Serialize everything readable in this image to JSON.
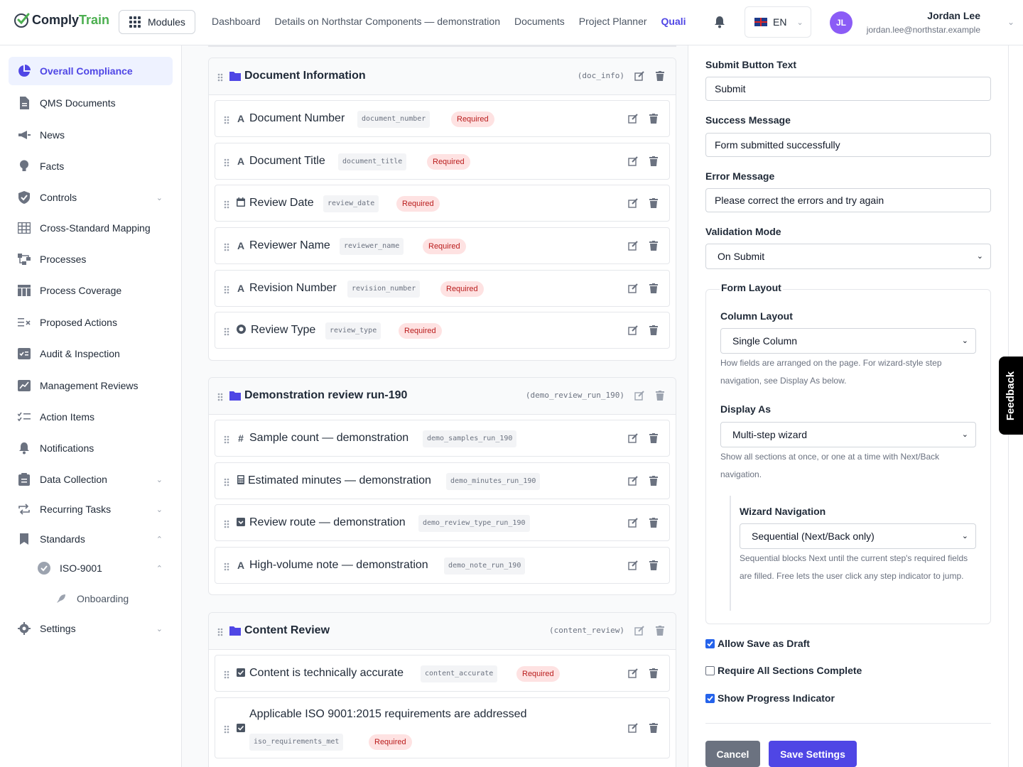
{
  "header": {
    "logo_part1": "Comply",
    "logo_part2": "Train",
    "modules_label": "Modules",
    "nav": [
      "Dashboard",
      "Details on Northstar Components — demonstration",
      "Documents",
      "Project Planner",
      "Quali"
    ],
    "language": "EN",
    "user": {
      "initials": "JL",
      "name": "Jordan Lee",
      "email": "jordan.lee@northstar.example"
    }
  },
  "sidebar": {
    "items": [
      {
        "label": "Overall Compliance",
        "icon": "pie-chart-icon",
        "active": true
      },
      {
        "label": "QMS Documents",
        "icon": "document-icon"
      },
      {
        "label": "News",
        "icon": "megaphone-icon"
      },
      {
        "label": "Facts",
        "icon": "lightbulb-icon"
      },
      {
        "label": "Controls",
        "icon": "shield-icon",
        "expandable": true
      },
      {
        "label": "Cross-Standard Mapping",
        "icon": "table-icon"
      },
      {
        "label": "Processes",
        "icon": "flow-icon"
      },
      {
        "label": "Process Coverage",
        "icon": "columns-icon"
      },
      {
        "label": "Proposed Actions",
        "icon": "list-x-icon"
      },
      {
        "label": "Audit & Inspection",
        "icon": "clipboard-check-icon"
      },
      {
        "label": "Management Reviews",
        "icon": "chart-review-icon"
      },
      {
        "label": "Action Items",
        "icon": "checklist-icon"
      },
      {
        "label": "Notifications",
        "icon": "bell-icon"
      },
      {
        "label": "Data Collection",
        "icon": "clipboard-icon",
        "expandable": true
      },
      {
        "label": "Recurring Tasks",
        "icon": "repeat-icon",
        "expandable": true
      },
      {
        "label": "Standards",
        "icon": "bookmark-icon",
        "expanded": true
      },
      {
        "label": "ISO-9001",
        "icon": "badge-check-icon",
        "expanded": true
      },
      {
        "label": "Onboarding",
        "icon": "rocket-icon"
      },
      {
        "label": "Settings",
        "icon": "gear-icon",
        "expandable": true
      }
    ]
  },
  "sections": [
    {
      "title": "Document Information",
      "key": "(doc_info)",
      "fields": [
        {
          "icon": "A",
          "label": "Document Number",
          "key": "document_number",
          "required": "Required"
        },
        {
          "icon": "A",
          "label": "Document Title",
          "key": "document_title",
          "required": "Required"
        },
        {
          "icon": "cal",
          "label": "Review Date",
          "key": "review_date",
          "required": "Required"
        },
        {
          "icon": "A",
          "label": "Reviewer Name",
          "key": "reviewer_name",
          "required": "Required"
        },
        {
          "icon": "A",
          "label": "Revision Number",
          "key": "revision_number",
          "required": "Required"
        },
        {
          "icon": "radio",
          "label": "Review Type",
          "key": "review_type",
          "required": "Required"
        }
      ]
    },
    {
      "title": "Demonstration review run-190",
      "key": "(demo_review_run_190)",
      "fields": [
        {
          "icon": "#",
          "label": "Sample count — demonstration",
          "key": "demo_samples_run_190"
        },
        {
          "icon": "calc",
          "label": "Estimated minutes — demonstration",
          "key": "demo_minutes_run_190"
        },
        {
          "icon": "select",
          "label": "Review route — demonstration",
          "key": "demo_review_type_run_190"
        },
        {
          "icon": "A",
          "label": "High-volume note — demonstration",
          "key": "demo_note_run_190"
        }
      ]
    },
    {
      "title": "Content Review",
      "key": "(content_review)",
      "fields": [
        {
          "icon": "check",
          "label": "Content is technically accurate",
          "key": "content_accurate",
          "required": "Required"
        },
        {
          "icon": "check",
          "label": "Applicable ISO 9001:2015 requirements are addressed",
          "key": "iso_requirements_met",
          "required": "Required"
        }
      ]
    }
  ],
  "settings": {
    "submit_label": "Submit Button Text",
    "submit_value": "Submit",
    "success_label": "Success Message",
    "success_value": "Form submitted successfully",
    "error_label": "Error Message",
    "error_value": "Please correct the errors and try again",
    "validation_label": "Validation Mode",
    "validation_value": "On Submit",
    "layout_legend": "Form Layout",
    "column_label": "Column Layout",
    "column_value": "Single Column",
    "column_help": "How fields are arranged on the page. For wizard-style step navigation, see Display As below.",
    "display_label": "Display As",
    "display_value": "Multi-step wizard",
    "display_help": "Show all sections at once, or one at a time with Next/Back navigation.",
    "wizard_label": "Wizard Navigation",
    "wizard_value": "Sequential (Next/Back only)",
    "wizard_help": "Sequential blocks Next until the current step's required fields are filled. Free lets the user click any step indicator to jump.",
    "checks": [
      {
        "label": "Allow Save as Draft",
        "checked": true
      },
      {
        "label": "Require All Sections Complete",
        "checked": false
      },
      {
        "label": "Show Progress Indicator",
        "checked": true
      }
    ],
    "cancel": "Cancel",
    "save": "Save Settings"
  },
  "feedback": "Feedback",
  "colors": {
    "accent": "#4f46e5",
    "required_bg": "#fee2e2",
    "required_text": "#b91c1c",
    "cancel": "#6b7280"
  }
}
